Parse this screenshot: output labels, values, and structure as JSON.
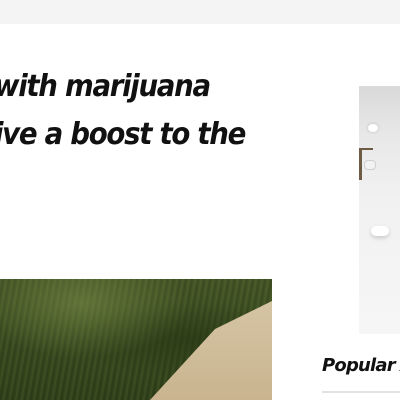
{
  "article": {
    "headline_lines": [
      "with marijuana",
      "ive a boost to the"
    ]
  },
  "sidebar": {
    "heading": "Popular A"
  }
}
